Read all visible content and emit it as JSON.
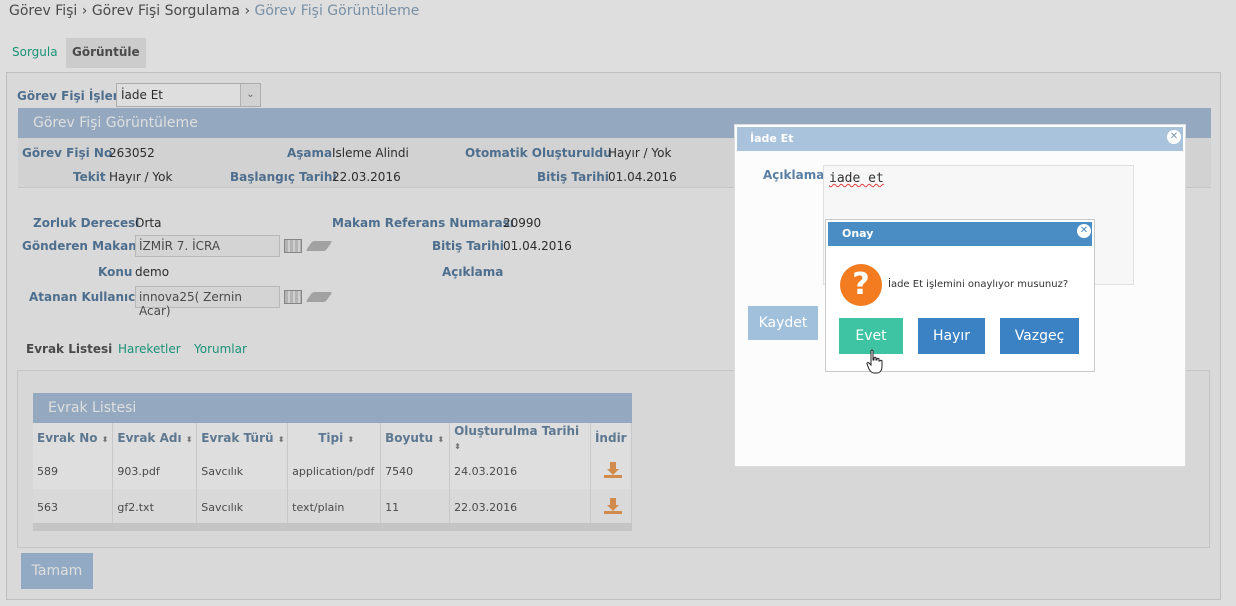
{
  "breadcrumb": {
    "item1": "Görev Fişi",
    "sep": " › ",
    "item2": "Görev Fişi Sorgulama",
    "current": "Görev Fişi Görüntüleme"
  },
  "page_tabs": {
    "sorgula": "Sorgula",
    "goruntule": "Görüntüle"
  },
  "islem": {
    "label": "Görev Fişi İşlem",
    "value": "İade Et"
  },
  "view_header": "Görev Fişi Görüntüleme",
  "info": {
    "gorev_fisi_no_label": "Görev Fişi No",
    "gorev_fisi_no": "263052",
    "asama_label": "Aşama",
    "asama": "Isleme Alindi",
    "otomatik_label": "Otomatik Oluşturuldu",
    "otomatik": "Hayır / Yok",
    "tekit_label": "Tekit",
    "tekit": "Hayır / Yok",
    "baslangic_label": "Başlangıç Tarihi",
    "baslangic": "22.03.2016",
    "bitis_label": "Bitiş Tarihi",
    "bitis": "01.04.2016"
  },
  "details": {
    "zorluk_label": "Zorluk Derecesi",
    "zorluk": "Orta",
    "makam_ref_label": "Makam Referans Numarası",
    "makam_ref": "20990",
    "gonderen_label": "Gönderen Makam",
    "gonderen": "İZMİR 7. İCRA",
    "bitis_label": "Bitiş Tarihi",
    "bitis": "01.04.2016",
    "konu_label": "Konu",
    "konu": "demo",
    "aciklama_label": "Açıklama",
    "atanan_label": "Atanan Kullanıcı",
    "atanan": "innova25( Zernin Acar)"
  },
  "sub_tabs": {
    "evrak": "Evrak Listesi",
    "hareketler": "Hareketler",
    "yorumlar": "Yorumlar"
  },
  "evrak": {
    "title": "Evrak Listesi",
    "columns": [
      "Evrak No",
      "Evrak Adı",
      "Evrak Türü",
      "Tipi",
      "Boyutu",
      "Oluşturulma Tarihi",
      "İndir"
    ],
    "sort_glyph": "⬍",
    "rows": [
      {
        "no": "589",
        "ad": "903.pdf",
        "tur": "Savcılık",
        "tip": "application/pdf",
        "boyut": "7540",
        "tarih": "24.03.2016"
      },
      {
        "no": "563",
        "ad": "gf2.txt",
        "tur": "Savcılık",
        "tip": "text/plain",
        "boyut": "11",
        "tarih": "22.03.2016"
      }
    ]
  },
  "tamam": "Tamam",
  "iade_dialog": {
    "title": "İade Et",
    "aciklama_label": "Açıklama",
    "text": "iade et",
    "kaydet": "Kaydet",
    "close": "✕"
  },
  "onay_dialog": {
    "title": "Onay",
    "icon": "?",
    "message": "İade Et işlemini onaylıyor musunuz?",
    "evet": "Evet",
    "hayir": "Hayır",
    "vazgec": "Vazgeç",
    "close": "✕"
  },
  "icons": {
    "select_arrow": "⌄"
  },
  "colors": {
    "accent": "#aac3dc",
    "primary": "#3b82c4",
    "success": "#3ec4a2",
    "warning": "#f47c20",
    "link": "#1fa98a"
  }
}
